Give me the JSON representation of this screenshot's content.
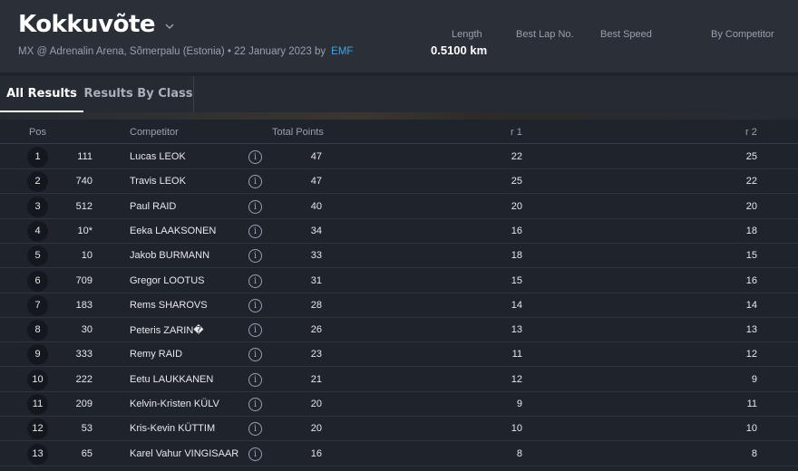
{
  "event": {
    "title": "Kokkuvõte",
    "subtitle": "MX @ Adrenalin Arena, Sõmerpalu (Estonia) • 22 January 2023 by",
    "organizer": "EMF"
  },
  "stats": {
    "length_label": "Length",
    "length_value": "0.5100 km",
    "best_lap_label": "Best Lap No.",
    "best_speed_label": "Best Speed",
    "by_competitor_label": "By Competitor"
  },
  "tabs": [
    {
      "label": "All Results",
      "active": true
    },
    {
      "label": "Results By Class",
      "active": false
    }
  ],
  "table": {
    "headers": {
      "pos": "Pos",
      "competitor": "Competitor",
      "total": "Total Points",
      "r1": "r 1",
      "r2": "r 2"
    },
    "rows": [
      {
        "pos": "1",
        "num": "111",
        "name": "Lucas LEOK",
        "points": "47",
        "r1": "22",
        "r2": "25"
      },
      {
        "pos": "2",
        "num": "740",
        "name": "Travis LEOK",
        "points": "47",
        "r1": "25",
        "r2": "22"
      },
      {
        "pos": "3",
        "num": "512",
        "name": "Paul RAID",
        "points": "40",
        "r1": "20",
        "r2": "20"
      },
      {
        "pos": "4",
        "num": "10*",
        "name": "Eeka LAAKSONEN",
        "points": "34",
        "r1": "16",
        "r2": "18"
      },
      {
        "pos": "5",
        "num": "10",
        "name": "Jakob BURMANN",
        "points": "33",
        "r1": "18",
        "r2": "15"
      },
      {
        "pos": "6",
        "num": "709",
        "name": "Gregor LOOTUS",
        "points": "31",
        "r1": "15",
        "r2": "16"
      },
      {
        "pos": "7",
        "num": "183",
        "name": "Rems SHAROVS",
        "points": "28",
        "r1": "14",
        "r2": "14"
      },
      {
        "pos": "8",
        "num": "30",
        "name": "Peteris ZARIN�",
        "points": "26",
        "r1": "13",
        "r2": "13"
      },
      {
        "pos": "9",
        "num": "333",
        "name": "Remy RAID",
        "points": "23",
        "r1": "11",
        "r2": "12"
      },
      {
        "pos": "10",
        "num": "222",
        "name": "Eetu LAUKKANEN",
        "points": "21",
        "r1": "12",
        "r2": "9"
      },
      {
        "pos": "11",
        "num": "209",
        "name": "Kelvin-Kristen KÜLV",
        "points": "20",
        "r1": "9",
        "r2": "11"
      },
      {
        "pos": "12",
        "num": "53",
        "name": "Kris-Kevin KÜTTIM",
        "points": "20",
        "r1": "10",
        "r2": "10"
      },
      {
        "pos": "13",
        "num": "65",
        "name": "Karel Vahur VINGISAAR",
        "points": "16",
        "r1": "8",
        "r2": "8"
      }
    ]
  },
  "icons": {
    "info": "info-icon",
    "chevron": "chevron-down-icon"
  },
  "colors": {
    "accent": "#3fa7e0",
    "background": "#1e232c",
    "header": "#2a2f38"
  }
}
